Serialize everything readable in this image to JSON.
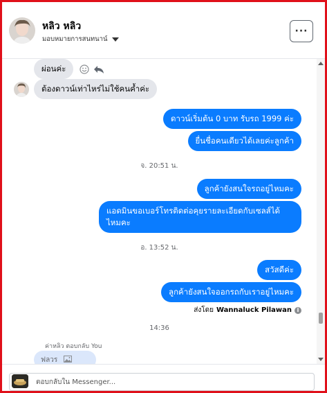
{
  "header": {
    "name": "หลิว หลิว",
    "assign_label": "มอบหมายการสนทนาน์",
    "more_label": "···"
  },
  "messages": {
    "in_1": "ผ่อนค่ะ",
    "in_2": "ต้องดาวน์เท่าไหร่ไม่ใช้คนค้ำค่ะ",
    "out_1": "ดาวน์เริ่มต้น 0 บาท รับรถ 1999 ค่ะ",
    "out_2": "ยื่นชื่อคนเดียวได้เลยค่ะลูกค้า",
    "ts_1": "จ. 20:51 น.",
    "out_3": "ลูกค้ายังสนใจรถอยู่ไหมคะ",
    "out_4": "แอดมินขอเบอร์โทรติดต่อคุยรายละเอียดกับเซลส์ได้ไหมคะ",
    "ts_2": "อ. 13:52 น.",
    "out_5": "สวัสดีค่ะ",
    "out_6": "ลูกค้ายังสนใจออกรถกับเราอยู่ไหมคะ",
    "sent_by_prefix": "ส่งโดย",
    "sent_by_name": "Wannaluck Pilawan",
    "ts_3": "14:36",
    "reply_label": "ค่าหลิว ตอบกลับ You",
    "reply_preview": "ฟลวร"
  },
  "composer": {
    "placeholder": "ตอบกลับใน Messenger..."
  },
  "colors": {
    "outgoing": "#0a7cff",
    "incoming": "#e4e6eb",
    "frame": "#e0101a"
  },
  "icons": [
    "more-icon",
    "caret-down-icon",
    "emoji-icon",
    "reply-icon",
    "info-icon",
    "image-icon",
    "scroll-up-icon",
    "scroll-down-icon"
  ]
}
